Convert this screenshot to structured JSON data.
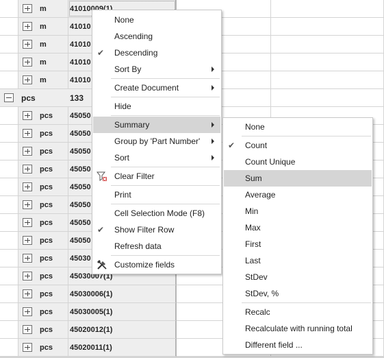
{
  "grid": {
    "rows": [
      {
        "unit": "m",
        "number": "41010009(1)"
      },
      {
        "unit": "m",
        "number": "41010"
      },
      {
        "unit": "m",
        "number": "41010"
      },
      {
        "unit": "m",
        "number": "41010"
      },
      {
        "unit": "m",
        "number": "41010"
      },
      {
        "group": true,
        "unit": "pcs",
        "number": "133"
      },
      {
        "unit": "pcs",
        "number": "45050"
      },
      {
        "unit": "pcs",
        "number": "45050"
      },
      {
        "unit": "pcs",
        "number": "45050"
      },
      {
        "unit": "pcs",
        "number": "45050"
      },
      {
        "unit": "pcs",
        "number": "45050"
      },
      {
        "unit": "pcs",
        "number": "45050"
      },
      {
        "unit": "pcs",
        "number": "45050"
      },
      {
        "unit": "pcs",
        "number": "45050"
      },
      {
        "unit": "pcs",
        "number": "45030"
      },
      {
        "unit": "pcs",
        "number": "45030007(1)"
      },
      {
        "unit": "pcs",
        "number": "45030006(1)"
      },
      {
        "unit": "pcs",
        "number": "45030005(1)"
      },
      {
        "unit": "pcs",
        "number": "45020012(1)"
      },
      {
        "unit": "pcs",
        "number": "45020011(1)"
      }
    ]
  },
  "context_menu": {
    "items": [
      {
        "label": "None"
      },
      {
        "label": "Ascending"
      },
      {
        "label": "Descending",
        "checked": true
      },
      {
        "label": "Sort By",
        "submenu": true
      },
      {
        "sep": true
      },
      {
        "label": "Create Document",
        "submenu": true
      },
      {
        "sep": true
      },
      {
        "label": "Hide"
      },
      {
        "sep": true
      },
      {
        "label": "Summary",
        "submenu": true,
        "highlighted": true
      },
      {
        "label": "Group by 'Part Number'",
        "submenu": true
      },
      {
        "label": "Sort",
        "submenu": true
      },
      {
        "sep": true
      },
      {
        "label": "Clear Filter",
        "icon": "clear-filter-icon"
      },
      {
        "sep": true
      },
      {
        "label": "Print"
      },
      {
        "sep": true
      },
      {
        "label": "Cell Selection Mode (F8)"
      },
      {
        "label": "Show Filter Row",
        "checked": true
      },
      {
        "label": "Refresh data"
      },
      {
        "sep": true
      },
      {
        "label": "Customize fields",
        "icon": "tools-icon"
      }
    ]
  },
  "summary_menu": {
    "items": [
      {
        "label": "None"
      },
      {
        "sep": true
      },
      {
        "label": "Count",
        "checked": true
      },
      {
        "label": "Count Unique"
      },
      {
        "label": "Sum",
        "highlighted": true
      },
      {
        "label": "Average"
      },
      {
        "label": "Min"
      },
      {
        "label": "Max"
      },
      {
        "label": "First"
      },
      {
        "label": "Last"
      },
      {
        "label": "StDev"
      },
      {
        "label": "StDev, %"
      },
      {
        "sep": true
      },
      {
        "label": "Recalc"
      },
      {
        "label": "Recalculate with running total"
      },
      {
        "label": "Different field ..."
      }
    ]
  },
  "icons": {
    "check": "✔",
    "checked_color": "#555555",
    "highlight_color": "#d5d5d5"
  }
}
